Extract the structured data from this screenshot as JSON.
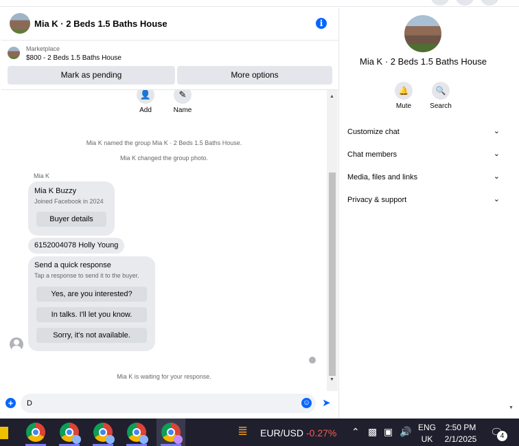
{
  "header": {
    "title": "Mia K · 2 Beds 1.5 Baths House",
    "info_icon": "info-icon"
  },
  "marketplace": {
    "label": "Marketplace",
    "listing": "$800 - 2 Beds 1.5 Baths House",
    "mark_pending": "Mark as pending",
    "more_options": "More options"
  },
  "tools": [
    {
      "label": "Add",
      "icon": "add-person-icon"
    },
    {
      "label": "Name",
      "icon": "pencil-icon"
    }
  ],
  "system_messages": {
    "named": "Mia K named the group Mia K · 2 Beds 1.5 Baths House.",
    "photo": "Mia K changed the group photo.",
    "waiting": "Mia K is waiting for your response."
  },
  "messages": {
    "sender": "Mia K",
    "profile_card": {
      "name": "Mia K Buzzy",
      "joined": "Joined Facebook in 2024",
      "button": "Buyer details"
    },
    "text_message": "6152004078 Holly Young",
    "quick_response": {
      "title": "Send a quick response",
      "subtitle": "Tap a response to send it to the buyer.",
      "options": [
        "Yes, are you interested?",
        "In talks. I'll let you know.",
        "Sorry, it's not available."
      ]
    }
  },
  "composer": {
    "value": "D"
  },
  "side_panel": {
    "name": "Mia K · 2 Beds 1.5 Baths House",
    "actions": [
      {
        "label": "Mute",
        "icon": "bell-icon"
      },
      {
        "label": "Search",
        "icon": "search-icon"
      }
    ],
    "sections": [
      "Customize chat",
      "Chat members",
      "Media, files and links",
      "Privacy & support"
    ]
  },
  "taskbar": {
    "currency_pair": "EUR/USD",
    "currency_change": "-0.27%",
    "lang_line1": "ENG",
    "lang_line2": "UK",
    "time": "2:50 PM",
    "date": "2/1/2025",
    "notification_count": "4"
  },
  "colors": {
    "accent": "#0866ff",
    "negative": "#ff5b4a",
    "taskbar": "#1f1f2e"
  }
}
